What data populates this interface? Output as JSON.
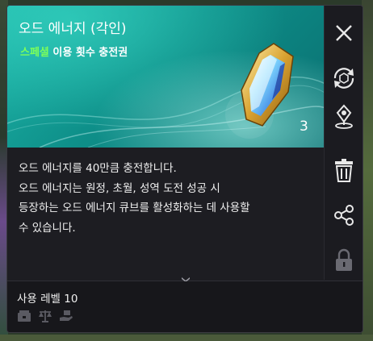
{
  "item": {
    "title": "오드 에너지 (각인)",
    "subtitle_highlight": "스페셜",
    "subtitle_rest": " 이용 횟수 충전권",
    "count": "3",
    "icon": "gem-shard-icon"
  },
  "description": [
    "오드 에너지를 40만큼 충전합니다.",
    "오드 에너지는 원정, 초월, 성역 도전 성공 시",
    "등장하는 오드 에너지 큐브를 활성화하는 데 사용할",
    "수 있습니다."
  ],
  "footer": {
    "level_label": "사용 레벨 10",
    "icons": [
      "storage-icon",
      "trade-scale-icon",
      "hand-give-icon"
    ]
  },
  "sidebar": {
    "buttons": [
      "close-icon",
      "cycle-icon",
      "map-pin-icon",
      "trash-icon",
      "share-icon",
      "lock-icon"
    ]
  },
  "colors": {
    "header_teal": "#11998f",
    "highlight_green": "#7dff5a",
    "panel_bg": "#1d1d22"
  }
}
